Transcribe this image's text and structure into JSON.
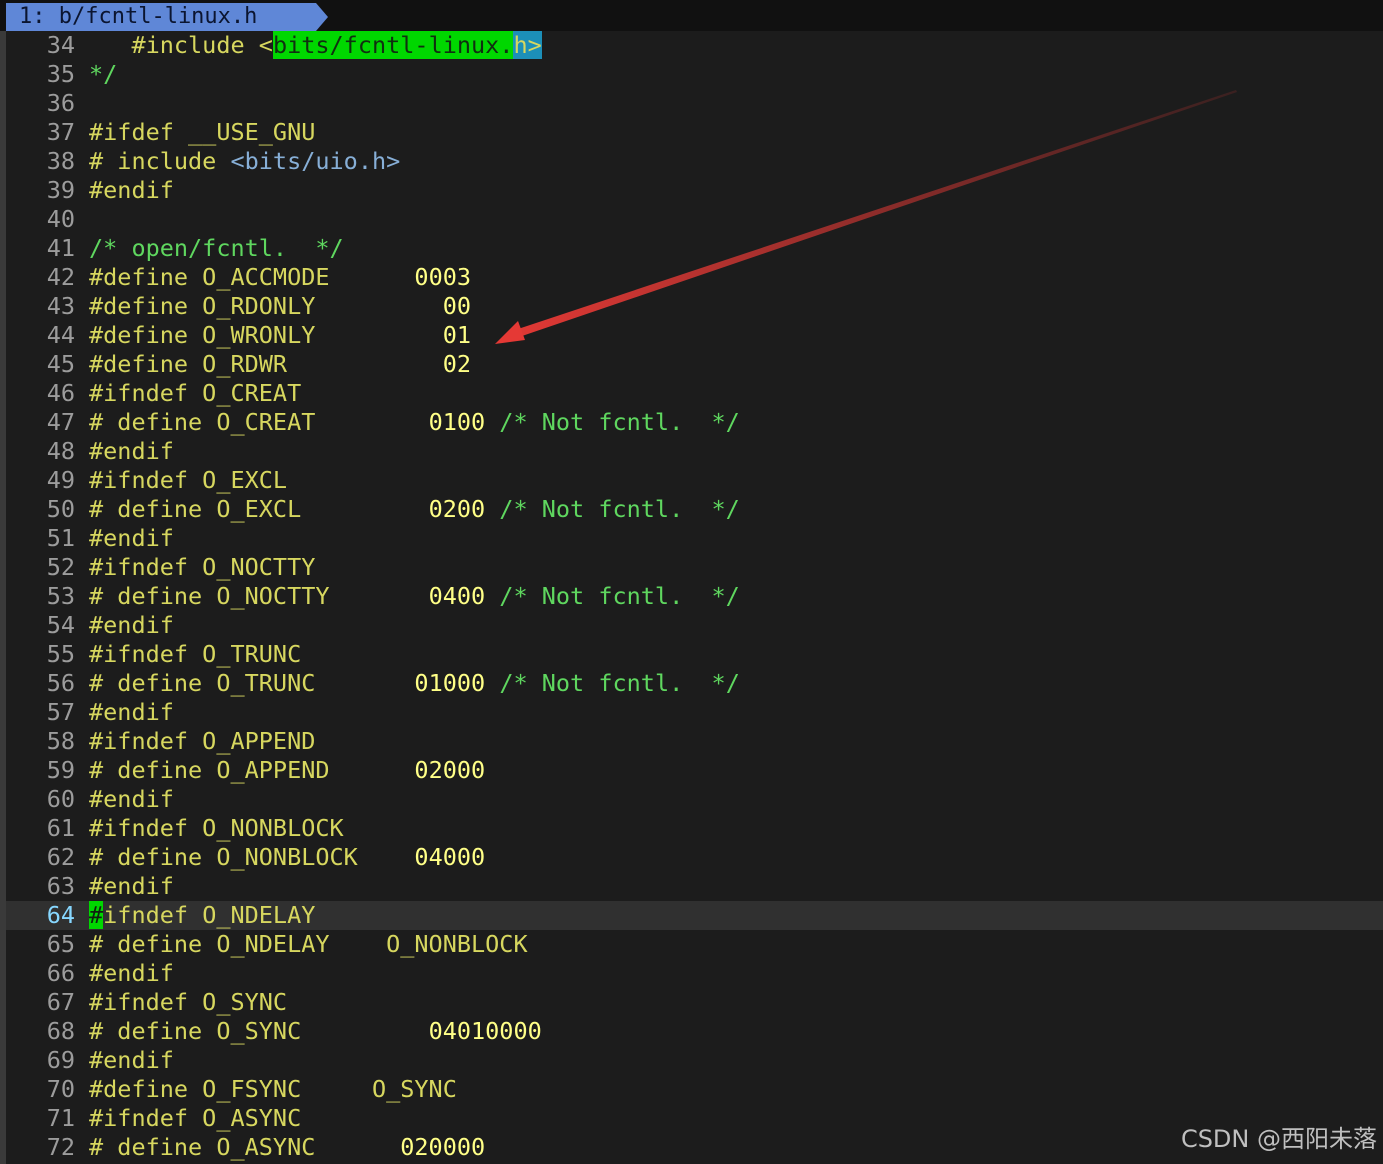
{
  "tab": {
    "label": "1: b/fcntl-linux.h"
  },
  "lines": [
    {
      "n": "34",
      "segs": [
        {
          "c": "dir",
          "t": "   #include "
        },
        {
          "c": "dir",
          "t": "<"
        },
        {
          "c": "hl",
          "t": "bits/fcntl-linux."
        },
        {
          "c": "sel",
          "t": "h>"
        }
      ]
    },
    {
      "n": "35",
      "segs": [
        {
          "c": "com",
          "t": "*/"
        }
      ]
    },
    {
      "n": "36",
      "segs": []
    },
    {
      "n": "37",
      "segs": [
        {
          "c": "dir",
          "t": "#ifdef __USE_GNU"
        }
      ]
    },
    {
      "n": "38",
      "segs": [
        {
          "c": "dir",
          "t": "# include "
        },
        {
          "c": "inc",
          "t": "<bits/uio.h>"
        }
      ]
    },
    {
      "n": "39",
      "segs": [
        {
          "c": "dir",
          "t": "#endif"
        }
      ]
    },
    {
      "n": "40",
      "segs": []
    },
    {
      "n": "41",
      "segs": [
        {
          "c": "com",
          "t": "/* open/fcntl.  */"
        }
      ]
    },
    {
      "n": "42",
      "segs": [
        {
          "c": "dir",
          "t": "#define O_ACCMODE      "
        },
        {
          "c": "num",
          "t": "0003"
        }
      ]
    },
    {
      "n": "43",
      "segs": [
        {
          "c": "dir",
          "t": "#define O_RDONLY         "
        },
        {
          "c": "num",
          "t": "00"
        }
      ]
    },
    {
      "n": "44",
      "segs": [
        {
          "c": "dir",
          "t": "#define O_WRONLY         "
        },
        {
          "c": "num",
          "t": "01"
        }
      ]
    },
    {
      "n": "45",
      "segs": [
        {
          "c": "dir",
          "t": "#define O_RDWR           "
        },
        {
          "c": "num",
          "t": "02"
        }
      ]
    },
    {
      "n": "46",
      "segs": [
        {
          "c": "dir",
          "t": "#ifndef O_CREAT"
        }
      ]
    },
    {
      "n": "47",
      "segs": [
        {
          "c": "dir",
          "t": "# define O_CREAT        "
        },
        {
          "c": "num",
          "t": "0100"
        },
        {
          "c": "com",
          "t": " /* Not fcntl.  */"
        }
      ]
    },
    {
      "n": "48",
      "segs": [
        {
          "c": "dir",
          "t": "#endif"
        }
      ]
    },
    {
      "n": "49",
      "segs": [
        {
          "c": "dir",
          "t": "#ifndef O_EXCL"
        }
      ]
    },
    {
      "n": "50",
      "segs": [
        {
          "c": "dir",
          "t": "# define O_EXCL         "
        },
        {
          "c": "num",
          "t": "0200"
        },
        {
          "c": "com",
          "t": " /* Not fcntl.  */"
        }
      ]
    },
    {
      "n": "51",
      "segs": [
        {
          "c": "dir",
          "t": "#endif"
        }
      ]
    },
    {
      "n": "52",
      "segs": [
        {
          "c": "dir",
          "t": "#ifndef O_NOCTTY"
        }
      ]
    },
    {
      "n": "53",
      "segs": [
        {
          "c": "dir",
          "t": "# define O_NOCTTY       "
        },
        {
          "c": "num",
          "t": "0400"
        },
        {
          "c": "com",
          "t": " /* Not fcntl.  */"
        }
      ]
    },
    {
      "n": "54",
      "segs": [
        {
          "c": "dir",
          "t": "#endif"
        }
      ]
    },
    {
      "n": "55",
      "segs": [
        {
          "c": "dir",
          "t": "#ifndef O_TRUNC"
        }
      ]
    },
    {
      "n": "56",
      "segs": [
        {
          "c": "dir",
          "t": "# define O_TRUNC       "
        },
        {
          "c": "num",
          "t": "01000"
        },
        {
          "c": "com",
          "t": " /* Not fcntl.  */"
        }
      ]
    },
    {
      "n": "57",
      "segs": [
        {
          "c": "dir",
          "t": "#endif"
        }
      ]
    },
    {
      "n": "58",
      "segs": [
        {
          "c": "dir",
          "t": "#ifndef O_APPEND"
        }
      ]
    },
    {
      "n": "59",
      "segs": [
        {
          "c": "dir",
          "t": "# define O_APPEND      "
        },
        {
          "c": "num",
          "t": "02000"
        }
      ]
    },
    {
      "n": "60",
      "segs": [
        {
          "c": "dir",
          "t": "#endif"
        }
      ]
    },
    {
      "n": "61",
      "segs": [
        {
          "c": "dir",
          "t": "#ifndef O_NONBLOCK"
        }
      ]
    },
    {
      "n": "62",
      "segs": [
        {
          "c": "dir",
          "t": "# define O_NONBLOCK    "
        },
        {
          "c": "num",
          "t": "04000"
        }
      ]
    },
    {
      "n": "63",
      "segs": [
        {
          "c": "dir",
          "t": "#endif"
        }
      ]
    },
    {
      "n": "64",
      "current": true,
      "segs": [
        {
          "c": "cur",
          "t": "#"
        },
        {
          "c": "dir",
          "t": "ifndef O_NDELAY"
        }
      ]
    },
    {
      "n": "65",
      "segs": [
        {
          "c": "dir",
          "t": "# define O_NDELAY    O_NONBLOCK"
        }
      ]
    },
    {
      "n": "66",
      "segs": [
        {
          "c": "dir",
          "t": "#endif"
        }
      ]
    },
    {
      "n": "67",
      "segs": [
        {
          "c": "dir",
          "t": "#ifndef O_SYNC"
        }
      ]
    },
    {
      "n": "68",
      "segs": [
        {
          "c": "dir",
          "t": "# define O_SYNC         "
        },
        {
          "c": "num",
          "t": "04010000"
        }
      ]
    },
    {
      "n": "69",
      "segs": [
        {
          "c": "dir",
          "t": "#endif"
        }
      ]
    },
    {
      "n": "70",
      "segs": [
        {
          "c": "dir",
          "t": "#define O_FSYNC     O_SYNC"
        }
      ]
    },
    {
      "n": "71",
      "segs": [
        {
          "c": "dir",
          "t": "#ifndef O_ASYNC"
        }
      ]
    },
    {
      "n": "72",
      "segs": [
        {
          "c": "dir",
          "t": "# define O_ASYNC      "
        },
        {
          "c": "num",
          "t": "020000"
        }
      ]
    }
  ],
  "annotation": {
    "arrow_color": "#e53935"
  },
  "watermark": "CSDN @西阳未落",
  "colors": {
    "background": "#1c1c1c",
    "tab": "#5f87d7",
    "directive": "#d7d75f",
    "number": "#ffff87",
    "comment": "#5fd75f",
    "include_path": "#87afd7",
    "match_highlight": "#00d700",
    "current_line": "#303030"
  }
}
